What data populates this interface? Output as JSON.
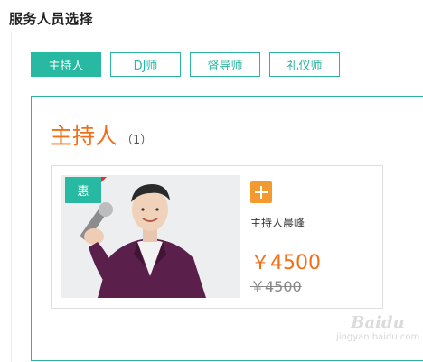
{
  "section": {
    "title": "服务人员选择"
  },
  "tabs": [
    {
      "label": "主持人",
      "active": true
    },
    {
      "label": "DJ师",
      "active": false
    },
    {
      "label": "督导师",
      "active": false
    },
    {
      "label": "礼仪师",
      "active": false
    }
  ],
  "panel": {
    "title": "主持人",
    "count": "（1）"
  },
  "card": {
    "badge": "惠",
    "name": "主持人晨峰",
    "price": "￥4500",
    "original_price": "￥4500",
    "add_icon": "plus-icon"
  },
  "watermark": {
    "logo": "Baidu",
    "sub": "jingyan.baidu.com"
  },
  "colors": {
    "accent": "#27b9a1",
    "price": "#f07019",
    "add_button": "#f39a2e"
  }
}
